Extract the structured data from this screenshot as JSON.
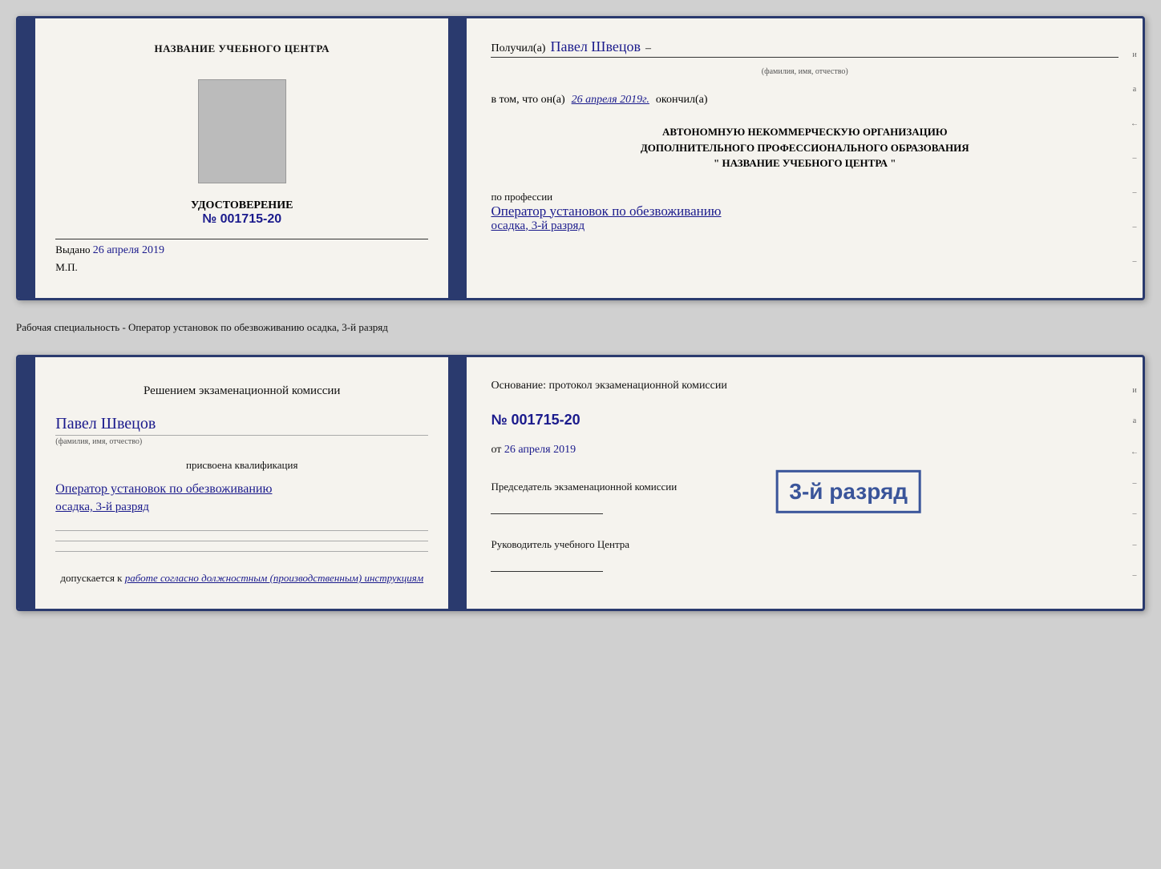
{
  "doc1": {
    "left": {
      "title": "НАЗВАНИЕ УЧЕБНОГО ЦЕНТРА",
      "cert_label": "УДОСТОВЕРЕНИЕ",
      "cert_number": "№ 001715-20",
      "issued_label": "Выдано",
      "issued_date": "26 апреля 2019",
      "mp": "М.П."
    },
    "right": {
      "received_prefix": "Получил(а)",
      "person_name": "Павел Швецов",
      "person_sublabel": "(фамилия, имя, отчество)",
      "dash": "–",
      "in_that": "в том, что он(а)",
      "date_handwritten": "26 апреля 2019г.",
      "finished": "окончил(а)",
      "org_line1": "АВТОНОМНУЮ НЕКОММЕРЧЕСКУЮ ОРГАНИЗАЦИЮ",
      "org_line2": "ДОПОЛНИТЕЛЬНОГО ПРОФЕССИОНАЛЬНОГО ОБРАЗОВАНИЯ",
      "org_line3": "\"   НАЗВАНИЕ УЧЕБНОГО ЦЕНТРА   \"",
      "profession_prefix": "по профессии",
      "profession_line1": "Оператор установок по обезвоживанию",
      "profession_line2": "осадка, 3-й разряд",
      "right_side_chars": [
        "и",
        "а",
        "←",
        "–",
        "–",
        "–",
        "–"
      ]
    }
  },
  "separator": {
    "text": "Рабочая специальность - Оператор установок по обезвоживанию осадка, 3-й разряд"
  },
  "doc2": {
    "left": {
      "decision_text": "Решением экзаменационной комиссии",
      "person_name": "Павел Швецов",
      "person_sublabel": "(фамилия, имя, отчество)",
      "assigned_label": "присвоена квалификация",
      "qualification_line1": "Оператор установок по обезвоживанию",
      "qualification_line2": "осадка, 3-й разряд",
      "sign_lines": [
        "",
        "",
        ""
      ],
      "allowed_prefix": "допускается к",
      "allowed_text": "работе согласно должностным (производственным) инструкциям"
    },
    "right": {
      "basis_text": "Основание: протокол экзаменационной комиссии",
      "protocol_number": "№ 001715-20",
      "date_prefix": "от",
      "date": "26 апреля 2019",
      "chairman_label": "Председатель экзаменационной комиссии",
      "head_label": "Руководитель учебного Центра",
      "right_side_chars": [
        "и",
        "а",
        "←",
        "–",
        "–",
        "–",
        "–"
      ]
    },
    "stamp": {
      "line1": "3-й разряд"
    }
  }
}
